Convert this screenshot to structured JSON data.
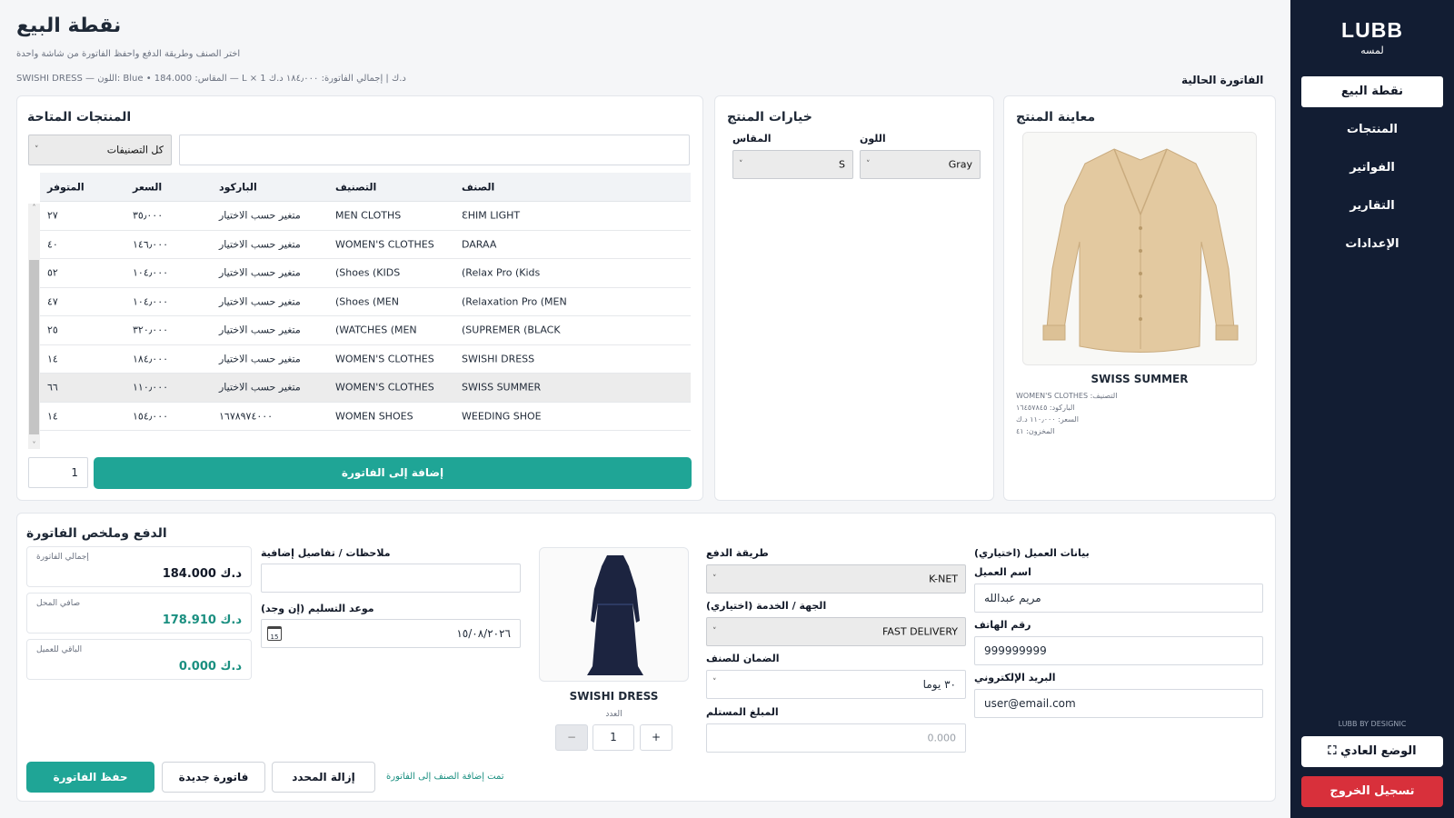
{
  "sidebar": {
    "brand": "LUBB",
    "brand_sub": "لمسه",
    "items": [
      {
        "label": "نقطة البيع"
      },
      {
        "label": "المنتجات"
      },
      {
        "label": "الفواتير"
      },
      {
        "label": "التقارير"
      },
      {
        "label": "الإعدادات"
      }
    ],
    "credit": "LUBB BY DESIGNIC",
    "normal_mode": "⛶ الوضع العادي",
    "logout": "تسجيل الخروج"
  },
  "header": {
    "title": "نقطة البيع",
    "subtitle": "اختر الصنف وطريقة الدفع واحفظ الفاتورة من شاشة واحدة",
    "invoice_summary": "SWISHI DRESS — اللون: Blue • المقاس: 184.000 — L × 1 د.ك   |   إجمالي الفاتورة: ١٨٤٫٠٠٠ د.ك",
    "current_invoice": "الفاتورة الحالية"
  },
  "products": {
    "title": "المنتجات المتاحة",
    "category_filter": "كل التصنيفات",
    "columns": {
      "name": "الصنف",
      "category": "التصنيف",
      "barcode": "الباركود",
      "price": "السعر",
      "stock": "المتوفر"
    },
    "rows": [
      {
        "name": "ƐHIM LIGHT",
        "category": "MEN CLOTHS",
        "barcode": "متغير حسب الاختيار",
        "price": "٣٥٫٠٠٠",
        "stock": "٢٧"
      },
      {
        "name": "DARAA",
        "category": "WOMEN'S CLOTHES",
        "barcode": "متغير حسب الاختيار",
        "price": "١٤٦٫٠٠٠",
        "stock": "٤٠"
      },
      {
        "name": "(Relax Pro (Kids",
        "category": "(Shoes (KIDS",
        "barcode": "متغير حسب الاختيار",
        "price": "١٠٤٫٠٠٠",
        "stock": "٥٢"
      },
      {
        "name": "(Relaxation Pro (MEN",
        "category": "(Shoes (MEN",
        "barcode": "متغير حسب الاختيار",
        "price": "١٠٤٫٠٠٠",
        "stock": "٤٧"
      },
      {
        "name": "(SUPREMER (BLACK",
        "category": "(WATCHES (MEN",
        "barcode": "متغير حسب الاختيار",
        "price": "٣٢٠٫٠٠٠",
        "stock": "٢٥"
      },
      {
        "name": "SWISHI DRESS",
        "category": "WOMEN'S CLOTHES",
        "barcode": "متغير حسب الاختيار",
        "price": "١٨٤٫٠٠٠",
        "stock": "١٤"
      },
      {
        "name": "SWISS SUMMER",
        "category": "WOMEN'S CLOTHES",
        "barcode": "متغير حسب الاختيار",
        "price": "١١٠٫٠٠٠",
        "stock": "٦٦"
      },
      {
        "name": "WEEDING SHOE",
        "category": "WOMEN SHOES",
        "barcode": "١٦٧٨٩٧٤٠٠٠",
        "price": "١٥٤٫٠٠٠",
        "stock": "١٤"
      }
    ],
    "selected_row": 6,
    "quantity": "1",
    "add_button": "إضافة إلى الفاتورة"
  },
  "options": {
    "title": "خيارات المنتج",
    "color_label": "اللون",
    "color_value": "Gray",
    "size_label": "المقاس",
    "size_value": "S"
  },
  "preview": {
    "title": "معاينة المنتج",
    "name": "SWISS SUMMER",
    "category": "التصنيف: WOMEN'S CLOTHES",
    "barcode": "الباركود: ١٦٤٥٧٨٤٥",
    "price": "السعر: ١١٠٫٠٠٠ د.ك",
    "stock": "المخزون: ٤١"
  },
  "payment": {
    "title": "الدفع وملخص الفاتورة",
    "total_label": "إجمالي الفاتورة",
    "total_value": "184.000 د.ك",
    "net_label": "صافي المحل",
    "net_value": "178.910 د.ك",
    "remain_label": "الباقي للعميل",
    "remain_value": "0.000 د.ك",
    "notes_label": "ملاحظات / تفاصيل إضافية",
    "delivery_label": "موعد التسليم (إن وجد)",
    "delivery_value": "١٥/٠٨/٢٠٢٦",
    "item_name": "SWISHI DRESS",
    "count_label": "العدد",
    "count_value": "1",
    "minus": "−",
    "plus": "+",
    "method_label": "طريقة الدفع",
    "method_value": "K-NET",
    "service_label": "الجهة / الخدمة (اختياري)",
    "service_value": "FAST DELIVERY",
    "warranty_label": "الضمان للصنف",
    "warranty_value": "٣٠ يوما",
    "received_label": "المبلغ المستلم",
    "received_placeholder": "0.000",
    "customer_title": "بيانات العميل (اختياري)",
    "customer_name_label": "اسم العميل",
    "customer_name": "مريم عبدالله",
    "phone_label": "رقم الهاتف",
    "phone": "999999999",
    "email_label": "البريد الإلكتروني",
    "email": "user@email.com",
    "save_button": "حفظ الفاتورة",
    "new_button": "فاتورة جديدة",
    "remove_button": "إزالة المحدد",
    "status_msg": "تمت إضافة الصنف إلى الفاتورة"
  },
  "colors": {
    "accent": "#1fa596",
    "sidebar": "#121d33",
    "danger": "#d8303b"
  }
}
